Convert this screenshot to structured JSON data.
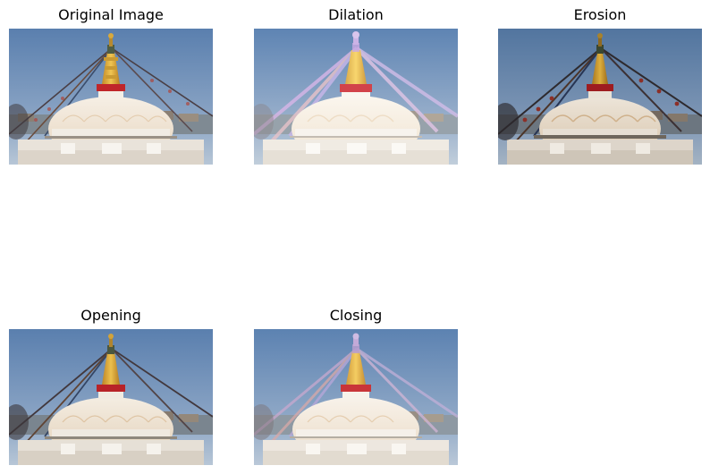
{
  "panels": [
    {
      "title": "Original Image",
      "variant": "original"
    },
    {
      "title": "Dilation",
      "variant": "dilation"
    },
    {
      "title": "Erosion",
      "variant": "erosion"
    },
    {
      "title": "Opening",
      "variant": "opening"
    },
    {
      "title": "Closing",
      "variant": "closing"
    }
  ],
  "colors": {
    "sky_top": "#5a7fae",
    "sky_bottom": "#a9bdd2",
    "dome": "#f3ece2",
    "spire_gold": "#e6b640",
    "band_red": "#c0262a",
    "flag_dark": "#3b3a3e",
    "flag_light": "#d8b6e8"
  }
}
